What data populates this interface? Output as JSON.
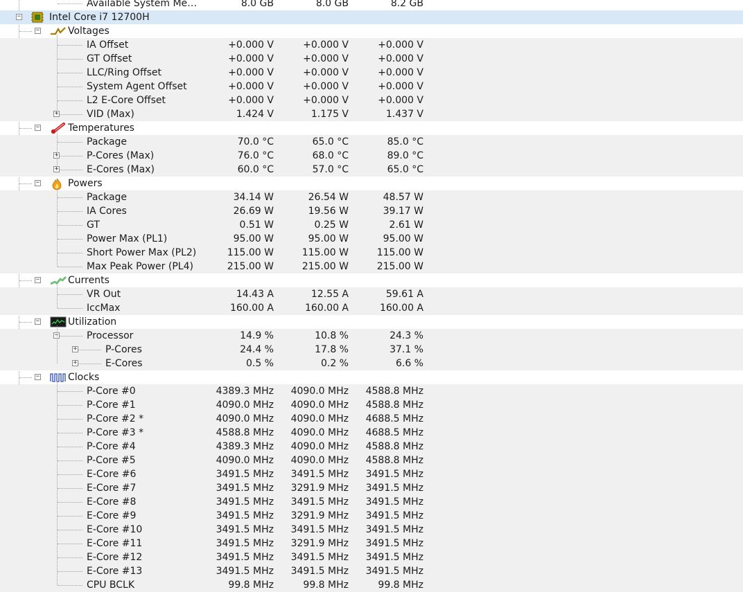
{
  "rows": [
    {
      "type": "leaf",
      "label": "Available System Me…",
      "v1": "8.0 GB",
      "v2": "8.0 GB",
      "v3": "8.2 GB",
      "depth": 2,
      "shade": false,
      "name": "row-available-system-memory"
    },
    {
      "type": "root",
      "label": "Intel Core i7 12700H",
      "icon": "cpu-chip-icon",
      "selected": true,
      "name": "row-intel-core-i7-12700h"
    },
    {
      "type": "group",
      "label": "Voltages",
      "icon": "voltage-icon",
      "name": "group-voltages"
    },
    {
      "type": "leaf",
      "label": "IA Offset",
      "v1": "+0.000 V",
      "v2": "+0.000 V",
      "v3": "+0.000 V",
      "depth": 2,
      "shade": true,
      "name": "row-ia-offset"
    },
    {
      "type": "leaf",
      "label": "GT Offset",
      "v1": "+0.000 V",
      "v2": "+0.000 V",
      "v3": "+0.000 V",
      "depth": 2,
      "shade": true,
      "name": "row-gt-offset"
    },
    {
      "type": "leaf",
      "label": "LLC/Ring Offset",
      "v1": "+0.000 V",
      "v2": "+0.000 V",
      "v3": "+0.000 V",
      "depth": 2,
      "shade": true,
      "name": "row-llc-ring-offset"
    },
    {
      "type": "leaf",
      "label": "System Agent Offset",
      "v1": "+0.000 V",
      "v2": "+0.000 V",
      "v3": "+0.000 V",
      "depth": 2,
      "shade": true,
      "name": "row-system-agent-offset"
    },
    {
      "type": "leaf",
      "label": "L2 E-Core Offset",
      "v1": "+0.000 V",
      "v2": "+0.000 V",
      "v3": "+0.000 V",
      "depth": 2,
      "shade": true,
      "name": "row-l2-e-core-offset"
    },
    {
      "type": "leaf",
      "label": "VID (Max)",
      "v1": "1.424 V",
      "v2": "1.175 V",
      "v3": "1.437 V",
      "depth": 2,
      "shade": true,
      "expand": true,
      "name": "row-vid-max"
    },
    {
      "type": "group",
      "label": "Temperatures",
      "icon": "thermometer-icon",
      "name": "group-temperatures"
    },
    {
      "type": "leaf",
      "label": "Package",
      "v1": "70.0 °C",
      "v2": "65.0 °C",
      "v3": "85.0 °C",
      "depth": 2,
      "shade": true,
      "name": "row-temp-package"
    },
    {
      "type": "leaf",
      "label": "P-Cores (Max)",
      "v1": "76.0 °C",
      "v2": "68.0 °C",
      "v3": "89.0 °C",
      "depth": 2,
      "shade": true,
      "expand": true,
      "name": "row-p-cores-max"
    },
    {
      "type": "leaf",
      "label": "E-Cores (Max)",
      "v1": "60.0 °C",
      "v2": "57.0 °C",
      "v3": "65.0 °C",
      "depth": 2,
      "shade": true,
      "expand": true,
      "name": "row-e-cores-max"
    },
    {
      "type": "group",
      "label": "Powers",
      "icon": "power-flame-icon",
      "name": "group-powers"
    },
    {
      "type": "leaf",
      "label": "Package",
      "v1": "34.14 W",
      "v2": "26.54 W",
      "v3": "48.57 W",
      "depth": 2,
      "shade": true,
      "name": "row-power-package"
    },
    {
      "type": "leaf",
      "label": "IA Cores",
      "v1": "26.69 W",
      "v2": "19.56 W",
      "v3": "39.17 W",
      "depth": 2,
      "shade": true,
      "name": "row-ia-cores"
    },
    {
      "type": "leaf",
      "label": "GT",
      "v1": "0.51 W",
      "v2": "0.25 W",
      "v3": "2.61 W",
      "depth": 2,
      "shade": true,
      "name": "row-gt"
    },
    {
      "type": "leaf",
      "label": "Power Max (PL1)",
      "v1": "95.00 W",
      "v2": "95.00 W",
      "v3": "95.00 W",
      "depth": 2,
      "shade": true,
      "name": "row-power-max-pl1"
    },
    {
      "type": "leaf",
      "label": "Short Power Max (PL2)",
      "v1": "115.00 W",
      "v2": "115.00 W",
      "v3": "115.00 W",
      "depth": 2,
      "shade": true,
      "name": "row-short-power-max-pl2"
    },
    {
      "type": "leaf",
      "label": "Max Peak Power (PL4)",
      "v1": "215.00 W",
      "v2": "215.00 W",
      "v3": "215.00 W",
      "depth": 2,
      "shade": true,
      "name": "row-max-peak-power-pl4"
    },
    {
      "type": "group",
      "label": "Currents",
      "icon": "current-graph-icon",
      "name": "group-currents"
    },
    {
      "type": "leaf",
      "label": "VR Out",
      "v1": "14.43 A",
      "v2": "12.55 A",
      "v3": "59.61 A",
      "depth": 2,
      "shade": true,
      "name": "row-vr-out"
    },
    {
      "type": "leaf",
      "label": "IccMax",
      "v1": "160.00 A",
      "v2": "160.00 A",
      "v3": "160.00 A",
      "depth": 2,
      "shade": true,
      "name": "row-iccmax"
    },
    {
      "type": "group",
      "label": "Utilization",
      "icon": "utilization-monitor-icon",
      "name": "group-utilization"
    },
    {
      "type": "leaf",
      "label": "Processor",
      "v1": "14.9 %",
      "v2": "10.8 %",
      "v3": "24.3 %",
      "depth": 2,
      "shade": true,
      "collapse": true,
      "name": "row-processor"
    },
    {
      "type": "leaf",
      "label": "P-Cores",
      "v1": "24.4 %",
      "v2": "17.8 %",
      "v3": "37.1 %",
      "depth": 3,
      "shade": true,
      "expand": true,
      "name": "row-util-p-cores"
    },
    {
      "type": "leaf",
      "label": "E-Cores",
      "v1": "0.5 %",
      "v2": "0.2 %",
      "v3": "6.6 %",
      "depth": 3,
      "shade": true,
      "expand": true,
      "name": "row-util-e-cores"
    },
    {
      "type": "group",
      "label": "Clocks",
      "icon": "clock-waveform-icon",
      "name": "group-clocks"
    },
    {
      "type": "leaf",
      "label": "P-Core #0",
      "v1": "4389.3 MHz",
      "v2": "4090.0 MHz",
      "v3": "4588.8 MHz",
      "depth": 2,
      "shade": true,
      "name": "row-p-core-0"
    },
    {
      "type": "leaf",
      "label": "P-Core #1",
      "v1": "4090.0 MHz",
      "v2": "4090.0 MHz",
      "v3": "4588.8 MHz",
      "depth": 2,
      "shade": true,
      "name": "row-p-core-1"
    },
    {
      "type": "leaf",
      "label": "P-Core #2 *",
      "v1": "4090.0 MHz",
      "v2": "4090.0 MHz",
      "v3": "4688.5 MHz",
      "depth": 2,
      "shade": true,
      "name": "row-p-core-2"
    },
    {
      "type": "leaf",
      "label": "P-Core #3 *",
      "v1": "4588.8 MHz",
      "v2": "4090.0 MHz",
      "v3": "4688.5 MHz",
      "depth": 2,
      "shade": true,
      "name": "row-p-core-3"
    },
    {
      "type": "leaf",
      "label": "P-Core #4",
      "v1": "4389.3 MHz",
      "v2": "4090.0 MHz",
      "v3": "4588.8 MHz",
      "depth": 2,
      "shade": true,
      "name": "row-p-core-4"
    },
    {
      "type": "leaf",
      "label": "P-Core #5",
      "v1": "4090.0 MHz",
      "v2": "4090.0 MHz",
      "v3": "4588.8 MHz",
      "depth": 2,
      "shade": true,
      "name": "row-p-core-5"
    },
    {
      "type": "leaf",
      "label": "E-Core #6",
      "v1": "3491.5 MHz",
      "v2": "3491.5 MHz",
      "v3": "3491.5 MHz",
      "depth": 2,
      "shade": true,
      "name": "row-e-core-6"
    },
    {
      "type": "leaf",
      "label": "E-Core #7",
      "v1": "3491.5 MHz",
      "v2": "3291.9 MHz",
      "v3": "3491.5 MHz",
      "depth": 2,
      "shade": true,
      "name": "row-e-core-7"
    },
    {
      "type": "leaf",
      "label": "E-Core #8",
      "v1": "3491.5 MHz",
      "v2": "3491.5 MHz",
      "v3": "3491.5 MHz",
      "depth": 2,
      "shade": true,
      "name": "row-e-core-8"
    },
    {
      "type": "leaf",
      "label": "E-Core #9",
      "v1": "3491.5 MHz",
      "v2": "3291.9 MHz",
      "v3": "3491.5 MHz",
      "depth": 2,
      "shade": true,
      "name": "row-e-core-9"
    },
    {
      "type": "leaf",
      "label": "E-Core #10",
      "v1": "3491.5 MHz",
      "v2": "3491.5 MHz",
      "v3": "3491.5 MHz",
      "depth": 2,
      "shade": true,
      "name": "row-e-core-10"
    },
    {
      "type": "leaf",
      "label": "E-Core #11",
      "v1": "3491.5 MHz",
      "v2": "3291.9 MHz",
      "v3": "3491.5 MHz",
      "depth": 2,
      "shade": true,
      "name": "row-e-core-11"
    },
    {
      "type": "leaf",
      "label": "E-Core #12",
      "v1": "3491.5 MHz",
      "v2": "3491.5 MHz",
      "v3": "3491.5 MHz",
      "depth": 2,
      "shade": true,
      "name": "row-e-core-12"
    },
    {
      "type": "leaf",
      "label": "E-Core #13",
      "v1": "3491.5 MHz",
      "v2": "3491.5 MHz",
      "v3": "3491.5 MHz",
      "depth": 2,
      "shade": true,
      "name": "row-e-core-13"
    },
    {
      "type": "leaf",
      "label": "CPU BCLK",
      "v1": "99.8 MHz",
      "v2": "99.8 MHz",
      "v3": "99.8 MHz",
      "depth": 2,
      "shade": true,
      "name": "row-cpu-bclk"
    }
  ]
}
